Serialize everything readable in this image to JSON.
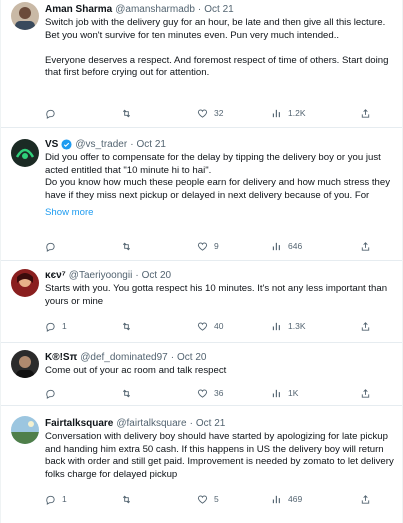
{
  "tweets": [
    {
      "name": "Aman Sharma",
      "handle": "@amansharmadb",
      "time": "Oct 21",
      "verified": false,
      "text": "Switch job with the delivery guy for an hour, be late and then give all this lecture. Bet you won't survive for ten minutes even. Pun very much intended..\n\nEveryone deserves a respect. And foremost respect of time of others. Start doing that first before crying out for attention.",
      "show_more": "",
      "replies": "",
      "retweets": "",
      "likes": "32",
      "views": "1.2K"
    },
    {
      "name": "VS",
      "handle": "@vs_trader",
      "time": "Oct 21",
      "verified": true,
      "text": "Did you offer to compensate for the delay by tipping the delivery boy or you just acted entitled that \"10 minute hi to hai\".\nDo you know how much these people earn for delivery and how much stress they have if they miss next pickup or delayed in next delivery because of you. For",
      "show_more": "Show more",
      "replies": "",
      "retweets": "",
      "likes": "9",
      "views": "646"
    },
    {
      "name": "κєν⁷",
      "handle": "@Taeriyoongii",
      "time": "Oct 20",
      "verified": false,
      "text": "Starts with you. You gotta respect his 10 minutes. It's not any less important than yours or mine",
      "show_more": "",
      "replies": "1",
      "retweets": "",
      "likes": "40",
      "views": "1.3K"
    },
    {
      "name": "K®!Sπ",
      "handle": "@def_dominated97",
      "time": "Oct 20",
      "verified": false,
      "text": "Come out of your ac room and talk respect",
      "show_more": "",
      "replies": "",
      "retweets": "",
      "likes": "36",
      "views": "1K"
    },
    {
      "name": "Fairtalksquare",
      "handle": "@fairtalksquare",
      "time": "Oct 21",
      "verified": false,
      "text": "Conversation with delivery boy should have started by apologizing for late pickup and handing him extra 50 cash. If this happens in US the delivery boy will return back with order and still get paid. Improvement is needed by zomato to let delivery folks charge for delayed pickup",
      "show_more": "",
      "replies": "1",
      "retweets": "",
      "likes": "5",
      "views": "469"
    }
  ],
  "sep": "·",
  "colors": {
    "accent": "#1d9bf0",
    "muted": "#536471",
    "text": "#0f1419"
  }
}
